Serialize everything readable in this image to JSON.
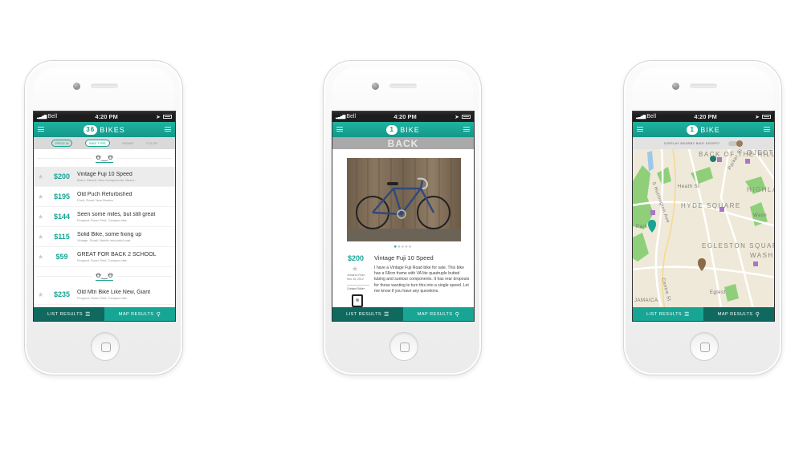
{
  "status_bar": {
    "carrier": "Bell",
    "time": "4:20 PM"
  },
  "list_screen": {
    "nav": {
      "count": "36",
      "title": "BIKES"
    },
    "filters": [
      "PRICE ⊕",
      "BIKE TYPE",
      "BRAND",
      "COLOR"
    ],
    "rows_group1": [
      {
        "price": "$200",
        "title": "Vintage Fuji 10 Speed",
        "sub": "Retro, Refurb, New Components, Beaut..."
      },
      {
        "price": "$195",
        "title": "Old Puch Refurbished",
        "sub": "Puch, Road, New Brakes"
      },
      {
        "price": "$144",
        "title": "Seen some miles, but still great",
        "sub": "Peugeot, Road, Red, Campus bike"
      },
      {
        "price": "$115",
        "title": "Solid Bike, some fixing up",
        "sub": "Vintage, Small, Needs new paint coat"
      },
      {
        "price": "$59",
        "title": "GREAT FOR BACK 2 SCHOOL",
        "sub": "Peugeot, Road, Red, Campus bike"
      }
    ],
    "rows_group2": [
      {
        "price": "$235",
        "title": "Old Mtn Bike Like New, Giant",
        "sub": "Peugeot, Road, Red, Campus bike"
      }
    ]
  },
  "detail_screen": {
    "nav": {
      "count": "1",
      "title": "BIKE"
    },
    "back_label": "BACK",
    "price": "$200",
    "title": "Vintage Fuji 10 Speed",
    "seller": "Jamarco Plum",
    "date": "Nov 16, 2012",
    "contact": "Contact Seller",
    "description": "I have a Vintage Fuji Road bike for sale. This bike has a 68cm frame with VA lite quadruple butted tubing and suntour components. It has rear dropouts for those wanting to turn this into a single speed. Let me know if you have any questions."
  },
  "map_screen": {
    "nav": {
      "count": "1",
      "title": "BIKE"
    },
    "toggle_label": "DISPLAY NEARBY BIKE SHOPS?",
    "labels": {
      "back_of_hill": "BACK OF THE HILL",
      "hyde_square": "HYDE SQUARE",
      "egleston_square": "EGLESTON SQUARE",
      "highland": "HIGHLA PARK",
      "heath_st": "Heath St",
      "huntington": "S Huntington Ave",
      "centre_st": "Centre St",
      "parker_st": "Parker St",
      "park": "Park",
      "washington": "WASH",
      "jamaica": "JAMAICA",
      "wash_st": "Wash",
      "eglest": "Eglest",
      "projects": "OJECTS"
    }
  },
  "tabbar": {
    "list": "LIST RESULTS",
    "map": "MAP RESULTS"
  },
  "colors": {
    "teal": "#17a594",
    "dark_teal": "#10695f",
    "pin_brown": "#8c6a4a"
  },
  "icons": [
    "signal-icon",
    "battery-icon",
    "menu-icon",
    "star-icon",
    "bike-icon",
    "list-icon",
    "pin-icon",
    "wifi-icon"
  ]
}
